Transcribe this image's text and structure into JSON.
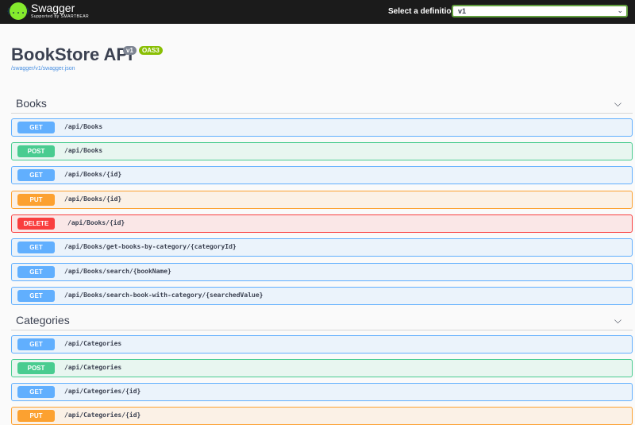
{
  "header": {
    "brand": "Swagger",
    "brand_sub": "Supported by SMARTBEAR",
    "logo_glyph": "{...}",
    "definition_label": "Select a definition",
    "definition_value": "v1",
    "colors": {
      "bar": "#1b1b1b",
      "logo": "#85ea2d",
      "select_border": "#62a03f"
    }
  },
  "info": {
    "title": "BookStore API",
    "version_badge": "v1",
    "oas_badge": "OAS3",
    "spec_link": "/swagger/v1/swagger.json"
  },
  "sections": [
    {
      "name": "Books",
      "expanded": true,
      "operations": [
        {
          "method": "GET",
          "path": "/api/Books"
        },
        {
          "method": "POST",
          "path": "/api/Books"
        },
        {
          "method": "GET",
          "path": "/api/Books/{id}"
        },
        {
          "method": "PUT",
          "path": "/api/Books/{id}"
        },
        {
          "method": "DELETE",
          "path": "/api/Books/{id}"
        },
        {
          "method": "GET",
          "path": "/api/Books/get-books-by-category/{categoryId}"
        },
        {
          "method": "GET",
          "path": "/api/Books/search/{bookName}"
        },
        {
          "method": "GET",
          "path": "/api/Books/search-book-with-category/{searchedValue}"
        }
      ]
    },
    {
      "name": "Categories",
      "expanded": true,
      "operations": [
        {
          "method": "GET",
          "path": "/api/Categories"
        },
        {
          "method": "POST",
          "path": "/api/Categories"
        },
        {
          "method": "GET",
          "path": "/api/Categories/{id}"
        },
        {
          "method": "PUT",
          "path": "/api/Categories/{id}"
        }
      ]
    }
  ],
  "method_colors": {
    "GET": "#61affe",
    "POST": "#49cc90",
    "PUT": "#fca130",
    "DELETE": "#f93e3e"
  }
}
